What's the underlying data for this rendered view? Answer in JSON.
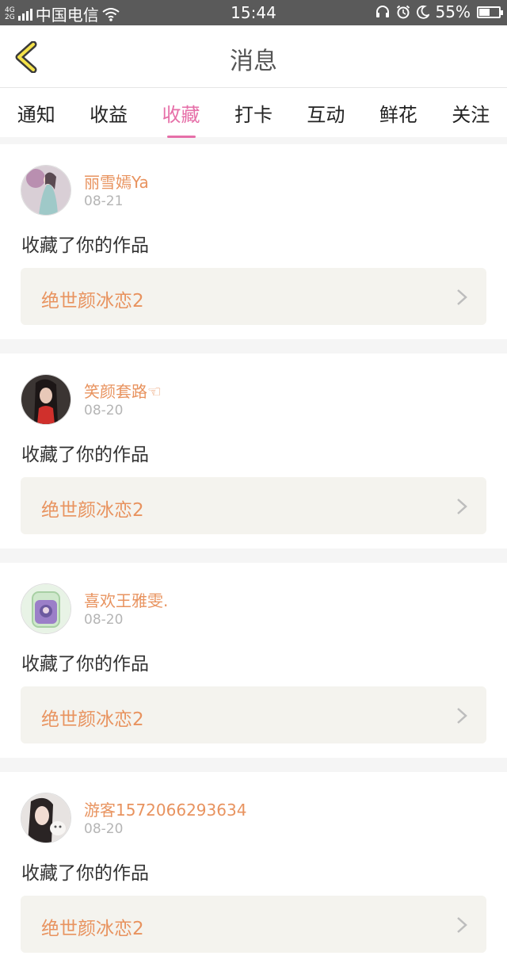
{
  "status_bar": {
    "network_top": "4G",
    "network_bottom": "2G",
    "carrier": "中国电信",
    "time": "15:44",
    "battery_text": "55%",
    "battery_level": 0.55
  },
  "header": {
    "title": "消息",
    "back_icon": "chevron-left-icon"
  },
  "tabs": [
    {
      "label": "通知",
      "active": false
    },
    {
      "label": "收益",
      "active": false
    },
    {
      "label": "收藏",
      "active": true
    },
    {
      "label": "打卡",
      "active": false
    },
    {
      "label": "互动",
      "active": false
    },
    {
      "label": "鲜花",
      "active": false
    },
    {
      "label": "关注",
      "active": false
    }
  ],
  "colors": {
    "accent_pink": "#e66fa8",
    "name_orange": "#e8935f",
    "work_bg": "#f4f3ee"
  },
  "notifications": [
    {
      "user": "丽雪嫣Ya",
      "date": "08-21",
      "action": "收藏了你的作品",
      "work": "绝世颜冰恋2"
    },
    {
      "user": "笑颜套路☜",
      "date": "08-20",
      "action": "收藏了你的作品",
      "work": "绝世颜冰恋2"
    },
    {
      "user": "喜欢王雅雯.",
      "date": "08-20",
      "action": "收藏了你的作品",
      "work": "绝世颜冰恋2"
    },
    {
      "user": "游客1572066293634",
      "date": "08-20",
      "action": "收藏了你的作品",
      "work": "绝世颜冰恋2"
    }
  ]
}
